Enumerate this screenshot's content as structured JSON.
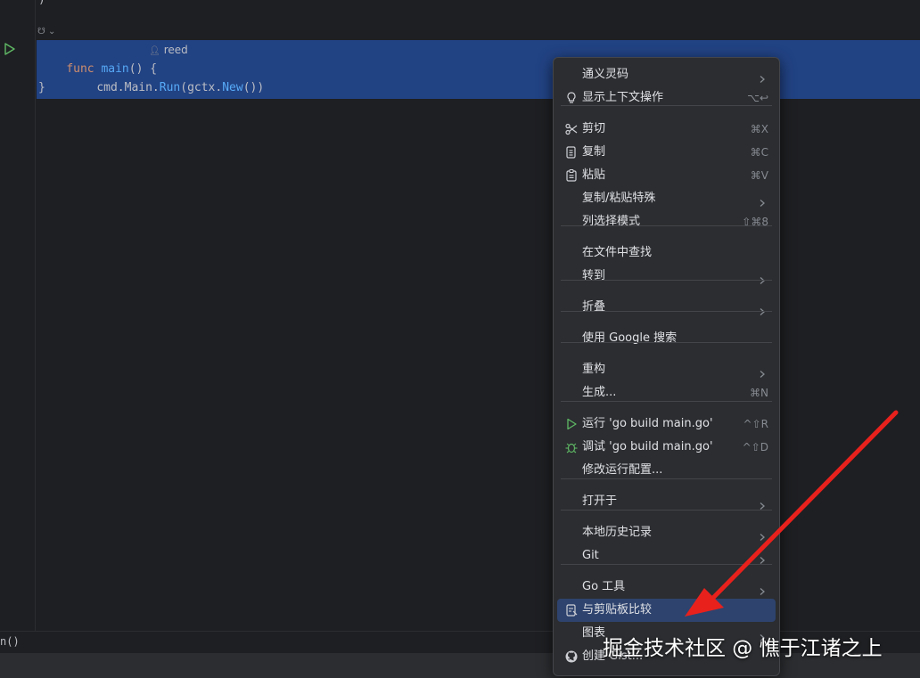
{
  "code": {
    "brace_top": ")",
    "hint": "☋ ⌄",
    "line1": {
      "kw": "func",
      "name": "main",
      "rest": "() {"
    },
    "author": "reed",
    "line2": {
      "pkg": "cmd.Main.",
      "call1": "Run",
      "p1": "(",
      "pkg2": "gctx.",
      "call2": "New",
      "p2": "())"
    },
    "line3": "}"
  },
  "breadcrumb": "n()",
  "menu": {
    "items": [
      {
        "label": "通义灵码",
        "shortcut": "",
        "submenu": true,
        "icon": ""
      },
      {
        "label": "显示上下文操作",
        "shortcut": "⌥↩",
        "submenu": false,
        "icon": "bulb-icon"
      },
      {
        "label": "剪切",
        "shortcut": "⌘X",
        "submenu": false,
        "icon": "scissors-icon"
      },
      {
        "label": "复制",
        "shortcut": "⌘C",
        "submenu": false,
        "icon": "copy-icon"
      },
      {
        "label": "粘贴",
        "shortcut": "⌘V",
        "submenu": false,
        "icon": "paste-icon"
      },
      {
        "label": "复制/粘贴特殊",
        "shortcut": "",
        "submenu": true,
        "icon": ""
      },
      {
        "label": "列选择模式",
        "shortcut": "⇧⌘8",
        "submenu": false,
        "icon": ""
      },
      {
        "label": "在文件中查找",
        "shortcut": "",
        "submenu": false,
        "icon": ""
      },
      {
        "label": "转到",
        "shortcut": "",
        "submenu": true,
        "icon": ""
      },
      {
        "label": "折叠",
        "shortcut": "",
        "submenu": true,
        "icon": ""
      },
      {
        "label": "使用 Google 搜索",
        "shortcut": "",
        "submenu": false,
        "icon": ""
      },
      {
        "label": "重构",
        "shortcut": "",
        "submenu": true,
        "icon": ""
      },
      {
        "label": "生成...",
        "shortcut": "⌘N",
        "submenu": false,
        "icon": ""
      },
      {
        "label": "运行 'go build main.go'",
        "shortcut": "^⇧R",
        "submenu": false,
        "icon": "run-icon"
      },
      {
        "label": "调试 'go build main.go'",
        "shortcut": "^⇧D",
        "submenu": false,
        "icon": "debug-icon"
      },
      {
        "label": "修改运行配置...",
        "shortcut": "",
        "submenu": false,
        "icon": ""
      },
      {
        "label": "打开于",
        "shortcut": "",
        "submenu": true,
        "icon": ""
      },
      {
        "label": "本地历史记录",
        "shortcut": "",
        "submenu": true,
        "icon": ""
      },
      {
        "label": "Git",
        "shortcut": "",
        "submenu": true,
        "icon": ""
      },
      {
        "label": "Go 工具",
        "shortcut": "",
        "submenu": true,
        "icon": ""
      },
      {
        "label": "与剪贴板比较",
        "shortcut": "",
        "submenu": false,
        "icon": "compare-clipboard-icon",
        "active": true
      },
      {
        "label": "图表",
        "shortcut": "",
        "submenu": true,
        "icon": ""
      },
      {
        "label": "创建 Gist...",
        "shortcut": "",
        "submenu": false,
        "icon": "github-icon"
      }
    ]
  },
  "watermark": "掘金技术社区 @ 憔于江诸之上",
  "colors": {
    "selection": "#214283",
    "menu_bg": "#2b2d30",
    "active_item": "#2e436e",
    "arrow": "#e8211d",
    "run_green": "#5fb865"
  }
}
